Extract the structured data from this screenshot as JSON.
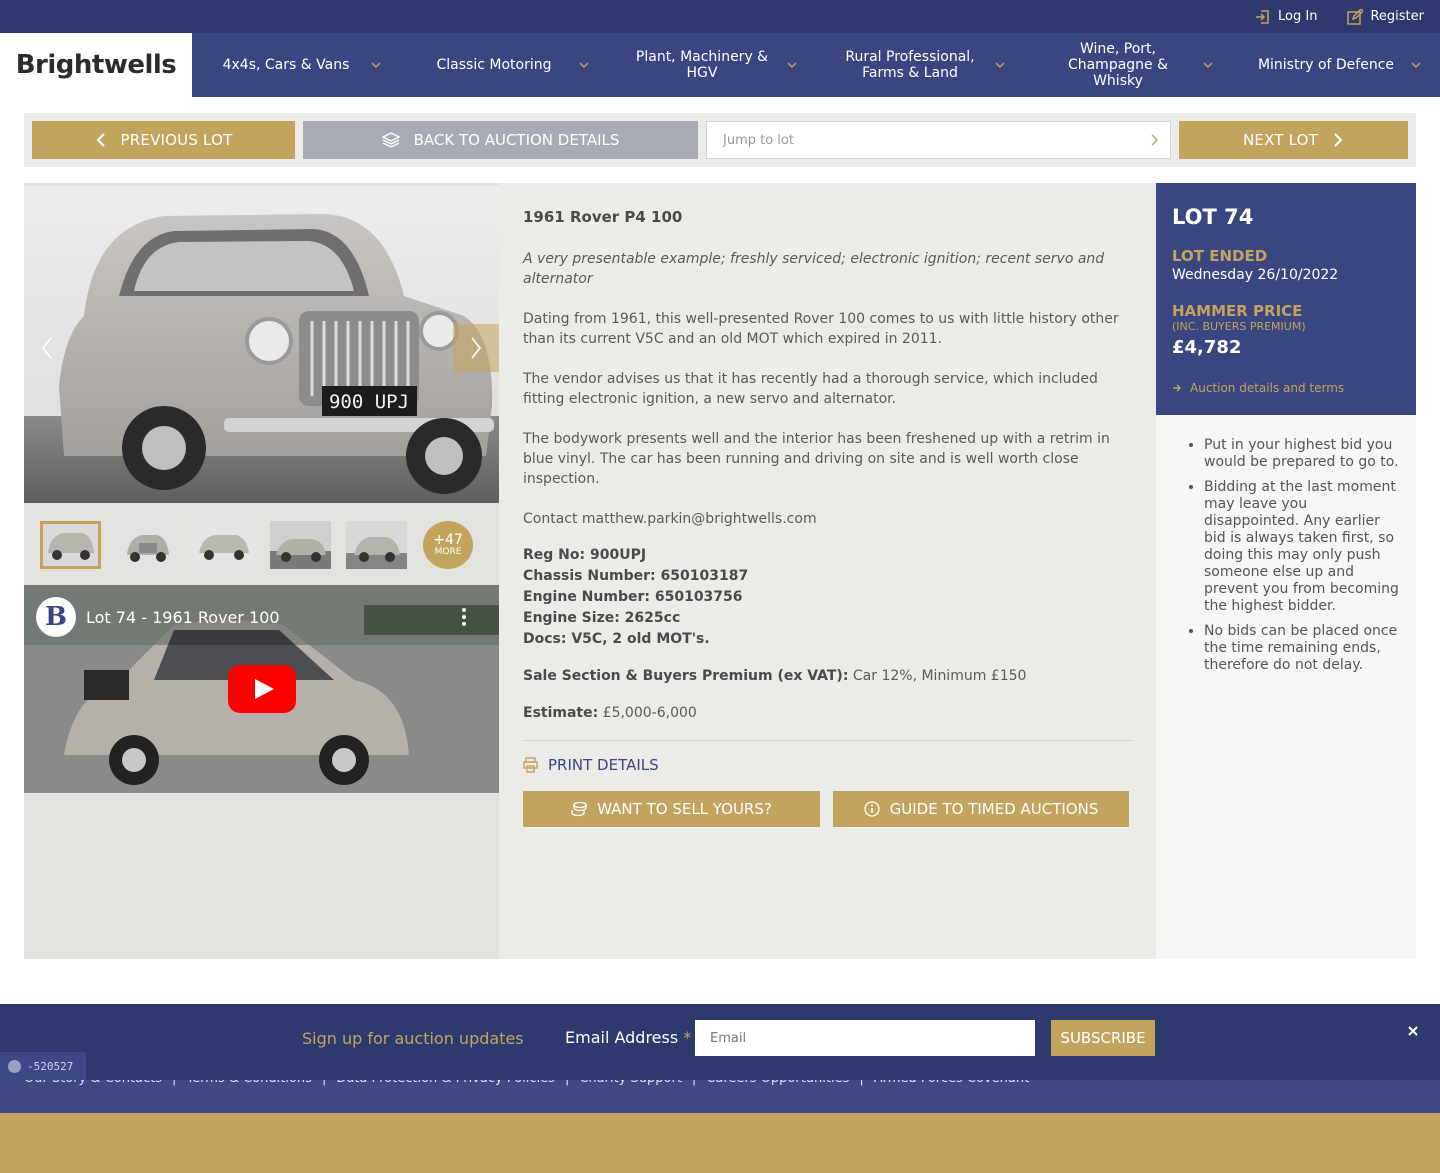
{
  "topbar": {
    "login_label": "Log In",
    "register_label": "Register"
  },
  "header": {
    "logo_text": "Brightwells",
    "nav": [
      {
        "label": "4x4s, Cars & Vans"
      },
      {
        "label": "Classic Motoring"
      },
      {
        "label": "Plant, Machinery & HGV"
      },
      {
        "label": "Rural Professional, Farms & Land"
      },
      {
        "label": "Wine, Port, Champagne & Whisky"
      },
      {
        "label": "Ministry of Defence"
      }
    ]
  },
  "lotnav": {
    "prev_label": "Previous Lot",
    "back_label": "Back to auction details",
    "jump_placeholder": "Jump to lot",
    "next_label": "Next Lot"
  },
  "gallery": {
    "more_count": "+47",
    "more_label": "MORE"
  },
  "video": {
    "title": "Lot 74 - 1961 Rover 100",
    "channel_initial": "B"
  },
  "lot": {
    "title": "1961 Rover P4 100",
    "subtitle": "A very presentable example; freshly serviced; electronic ignition; recent servo and alternator",
    "paragraphs": [
      "Dating from 1961, this well-presented Rover 100 comes to us with little history other than its current V5C and an old MOT which expired in 2011.",
      "The vendor advises us that it has recently had a thorough service, which included fitting electronic ignition, a new servo and alternator.",
      "The bodywork presents well and the interior has been freshened up with a retrim in blue vinyl. The car has been running and driving on site and is well worth close inspection.",
      "Contact matthew.parkin@brightwells.com"
    ],
    "specs": [
      "Reg No: 900UPJ",
      "Chassis Number: 650103187",
      "Engine Number: 650103756",
      "Engine Size: 2625cc",
      "Docs: V5C, 2 old MOT's."
    ],
    "sale_section_label": "Sale Section & Buyers Premium (ex VAT):",
    "sale_section_value": "Car 12%, Minimum £150",
    "estimate_label": "Estimate:",
    "estimate_value": "£5,000-6,000",
    "print_label": "Print details",
    "sell_label": "Want to sell yours?",
    "guide_label": "Guide to timed auctions"
  },
  "status": {
    "lot_number": "LOT 74",
    "ended_label": "Lot Ended",
    "ended_date": "Wednesday 26/10/2022",
    "hammer_label": "Hammer Price",
    "hammer_sub": "(Inc. Buyers Premium)",
    "hammer_price": "£4,782",
    "terms_link": "Auction details and terms"
  },
  "tips": [
    "Put in your highest bid you would be prepared to go to.",
    "Bidding at the last moment may leave you disappointed. Any earlier bid is always taken first, so doing this may only push someone else up and prevent you from becoming the highest bidder.",
    "No bids can be placed once the time remaining ends, therefore do not delay."
  ],
  "signup": {
    "heading": "Sign up for auction updates",
    "email_label": "Email Address",
    "required_mark": "*",
    "email_placeholder": "Email",
    "subscribe_label": "Subscribe"
  },
  "footer": {
    "links": [
      "Our Story & Contacts",
      "|",
      "Terms & Conditions",
      "|",
      "Data Protection & Privacy Policies",
      "|",
      "Charity Support",
      "|",
      "Careers Opportunities",
      "|",
      "Armed Forces Covenant"
    ]
  },
  "debug": {
    "value": "-520527"
  },
  "colors": {
    "navy": "#2e3a6e",
    "nav_blue": "#3a4680",
    "gold": "#c2a45e",
    "grey_button": "#a8abb3",
    "panel": "#ebebe7"
  }
}
